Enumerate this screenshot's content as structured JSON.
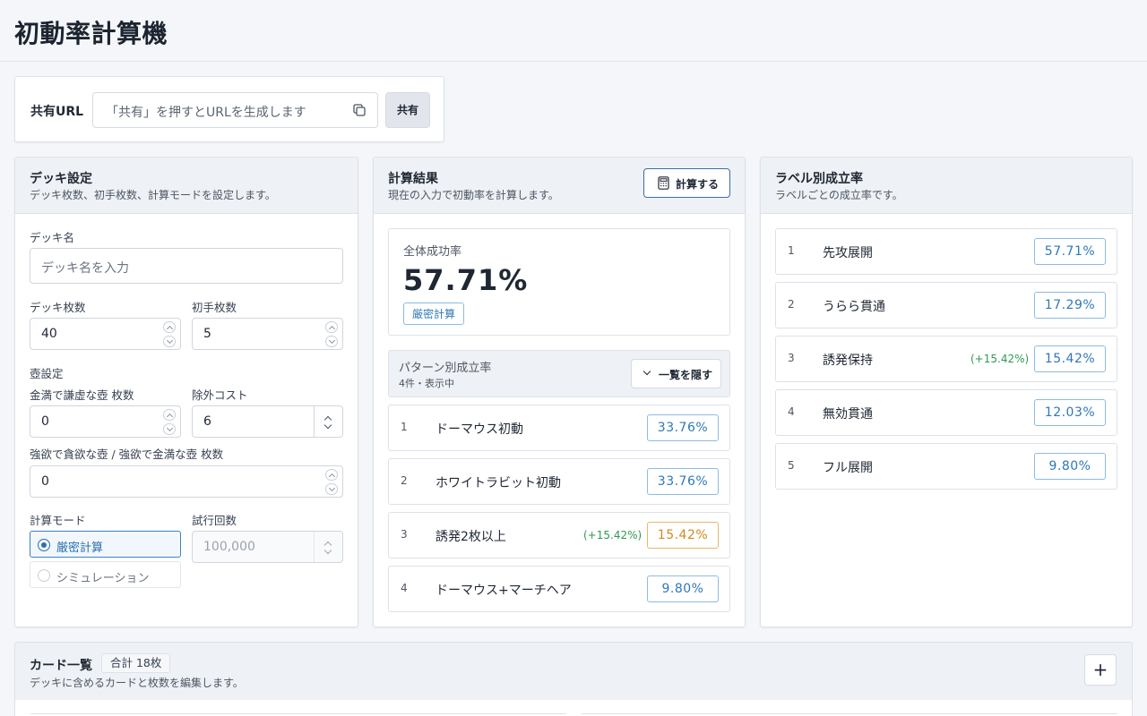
{
  "app": {
    "title": "初動率計算機"
  },
  "share": {
    "label": "共有URL",
    "placeholder": "「共有」を押すとURLを生成します",
    "button": "共有"
  },
  "deck": {
    "title": "デッキ設定",
    "subtitle": "デッキ枚数、初手枚数、計算モードを設定します。",
    "name_label": "デッキ名",
    "name_placeholder": "デッキ名を入力",
    "size_label": "デッキ枚数",
    "size_value": "40",
    "hand_label": "初手枚数",
    "hand_value": "5",
    "pot_section": "壺設定",
    "pot_modest_label": "金満で謙虚な壺 枚数",
    "pot_modest_value": "0",
    "exclude_cost_label": "除外コスト",
    "exclude_cost_value": "6",
    "pot_greed_label": "強欲で貪欲な壺 / 強欲で金満な壺 枚数",
    "pot_greed_value": "0",
    "mode_label": "計算モード",
    "mode_options": [
      "厳密計算",
      "シミュレーション"
    ],
    "mode_selected": "厳密計算",
    "trials_label": "試行回数",
    "trials_placeholder": "100,000"
  },
  "result": {
    "title": "計算結果",
    "subtitle": "現在の入力で初動率を計算します。",
    "calc_button": "計算する",
    "overall_label": "全体成功率",
    "overall_value": "57.71%",
    "mode_badge": "厳密計算",
    "patterns_title": "パターン別成立率",
    "patterns_meta": "4件・表示中",
    "hide_button": "一覧を隠す",
    "patterns": [
      {
        "index": "1",
        "name": "ドーマウス初動",
        "delta": "",
        "rate": "33.76%"
      },
      {
        "index": "2",
        "name": "ホワイトラビット初動",
        "delta": "",
        "rate": "33.76%"
      },
      {
        "index": "3",
        "name": "誘発2枚以上",
        "delta": "(+15.42%)",
        "rate": "15.42%"
      },
      {
        "index": "4",
        "name": "ドーマウス+マーチヘア",
        "delta": "",
        "rate": "9.80%"
      }
    ]
  },
  "labels": {
    "title": "ラベル別成立率",
    "subtitle": "ラベルごとの成立率です。",
    "items": [
      {
        "index": "1",
        "name": "先攻展開",
        "delta": "",
        "rate": "57.71%"
      },
      {
        "index": "2",
        "name": "うらら貫通",
        "delta": "",
        "rate": "17.29%"
      },
      {
        "index": "3",
        "name": "誘発保持",
        "delta": "(+15.42%)",
        "rate": "15.42%"
      },
      {
        "index": "4",
        "name": "無効貫通",
        "delta": "",
        "rate": "12.03%"
      },
      {
        "index": "5",
        "name": "フル展開",
        "delta": "",
        "rate": "9.80%"
      }
    ]
  },
  "cards": {
    "title": "カード一覧",
    "count": "合計 18枚",
    "subtitle": "デッキに含めるカードと枚数を編集します。",
    "add_button": "+"
  },
  "colors": {
    "accent": "#2f78b8",
    "warning": "#d08a1e",
    "positive": "#2e9a52"
  }
}
